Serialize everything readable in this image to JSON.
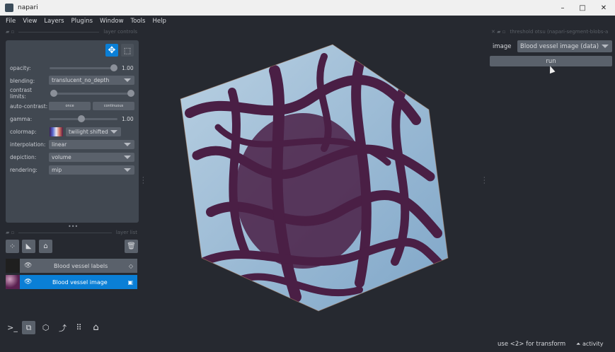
{
  "window": {
    "title": "napari",
    "min": "–",
    "max": "□",
    "close": "✕"
  },
  "menu": [
    "File",
    "View",
    "Layers",
    "Plugins",
    "Window",
    "Tools",
    "Help"
  ],
  "layer_controls": {
    "header": "layer controls",
    "opacity": {
      "label": "opacity:",
      "value": "1.00",
      "level": 1.0
    },
    "blending": {
      "label": "blending:",
      "value": "translucent_no_depth"
    },
    "contrast_limits": {
      "label": "contrast limits:",
      "range": [
        0,
        1
      ]
    },
    "auto_contrast": {
      "label": "auto-contrast:",
      "once": "once",
      "continuous": "continuous"
    },
    "gamma": {
      "label": "gamma:",
      "value": "1.00",
      "level": 0.5
    },
    "colormap": {
      "label": "colormap:",
      "value": "twilight shifted"
    },
    "interpolation": {
      "label": "interpolation:",
      "value": "linear"
    },
    "depiction": {
      "label": "depiction:",
      "value": "volume"
    },
    "rendering": {
      "label": "rendering:",
      "value": "mip"
    }
  },
  "layer_list": {
    "header": "layer list",
    "layers": [
      {
        "name": "Blood vessel labels",
        "type": "labels",
        "selected": false
      },
      {
        "name": "Blood vessel image",
        "type": "image",
        "selected": true
      }
    ]
  },
  "plugin": {
    "header": "threshold otsu (napari-segment-blobs-a",
    "image_label": "image",
    "image_value": "Blood vessel image (data)",
    "run": "run"
  },
  "status": {
    "message": "use <2> for transform",
    "activity": "activity"
  },
  "colors": {
    "accent": "#0a7fd6",
    "vessel": "#4a1f45",
    "background_tissue": "#9fbfd8"
  }
}
